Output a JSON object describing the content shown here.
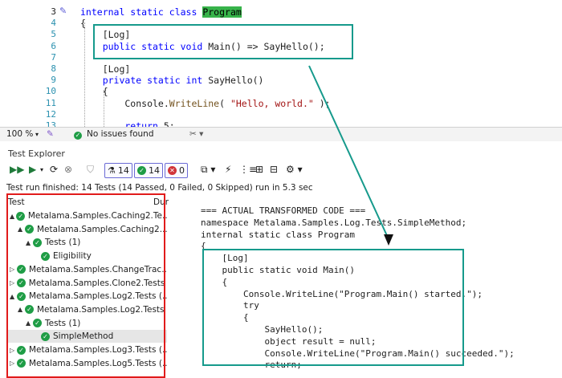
{
  "editor": {
    "line_numbers": [
      "3",
      "4",
      "5",
      "6",
      "7",
      "8",
      "9",
      "10",
      "11",
      "12",
      "13"
    ],
    "lines": [
      {
        "parts": [
          {
            "t": "internal static class ",
            "c": "kw"
          },
          {
            "t": "Program",
            "c": "hl"
          }
        ]
      },
      {
        "parts": [
          {
            "t": "{",
            "c": "ident"
          }
        ]
      },
      {
        "parts": [
          {
            "t": "    [Log]",
            "c": "ident"
          }
        ]
      },
      {
        "parts": [
          {
            "t": "    public static void ",
            "c": "kw"
          },
          {
            "t": "Main() => SayHello();",
            "c": "ident"
          }
        ]
      },
      {
        "parts": [
          {
            "t": "",
            "c": "ident"
          }
        ]
      },
      {
        "parts": [
          {
            "t": "    [Log]",
            "c": "ident"
          }
        ]
      },
      {
        "parts": [
          {
            "t": "    private static int ",
            "c": "kw"
          },
          {
            "t": "SayHello()",
            "c": "ident"
          }
        ]
      },
      {
        "parts": [
          {
            "t": "    {",
            "c": "ident"
          }
        ]
      },
      {
        "parts": [
          {
            "t": "        Console.",
            "c": "ident"
          },
          {
            "t": "WriteLine",
            "c": "method"
          },
          {
            "t": "( ",
            "c": "ident"
          },
          {
            "t": "\"Hello, world.\"",
            "c": "str"
          },
          {
            "t": " );",
            "c": "ident"
          }
        ]
      },
      {
        "parts": [
          {
            "t": "",
            "c": "ident"
          }
        ]
      },
      {
        "parts": [
          {
            "t": "        return ",
            "c": "kw"
          },
          {
            "t": "5;",
            "c": "ident"
          }
        ]
      }
    ],
    "annotation_lines": [
      "[Log]",
      "public static void Main() => SayHello();"
    ]
  },
  "statusbar": {
    "zoom": "100 %",
    "issues": "No issues found"
  },
  "test_explorer": {
    "title": "Test Explorer",
    "badges": {
      "total": "14",
      "passed": "14",
      "failed": "0"
    },
    "summary": "Test run finished: 14 Tests (14 Passed, 0 Failed, 0 Skipped) run in 5.3 sec",
    "tree_header": {
      "test": "Test",
      "duration": "Dur"
    },
    "tree": [
      {
        "label": "Metalama.Samples.Caching2.Te...",
        "depth": 0,
        "arrow": "▲",
        "selected": false
      },
      {
        "label": "Metalama.Samples.Caching2....",
        "depth": 1,
        "arrow": "▲",
        "selected": false
      },
      {
        "label": "Tests (1)",
        "depth": 2,
        "arrow": "▲",
        "selected": false
      },
      {
        "label": "Eligibility",
        "depth": 3,
        "arrow": "",
        "selected": false
      },
      {
        "label": "Metalama.Samples.ChangeTrac...",
        "depth": 0,
        "arrow": "▷",
        "selected": false
      },
      {
        "label": "Metalama.Samples.Clone2.Tests .",
        "depth": 0,
        "arrow": "▷",
        "selected": false
      },
      {
        "label": "Metalama.Samples.Log2.Tests (...",
        "depth": 0,
        "arrow": "▲",
        "selected": false
      },
      {
        "label": "Metalama.Samples.Log2.Tests ...",
        "depth": 1,
        "arrow": "▲",
        "selected": false
      },
      {
        "label": "Tests (1)",
        "depth": 2,
        "arrow": "▲",
        "selected": false
      },
      {
        "label": "SimpleMethod",
        "depth": 3,
        "arrow": "",
        "selected": true
      },
      {
        "label": "Metalama.Samples.Log3.Tests (...",
        "depth": 0,
        "arrow": "▷",
        "selected": false
      },
      {
        "label": "Metalama.Samples.Log5.Tests (...",
        "depth": 0,
        "arrow": "▷",
        "selected": false
      }
    ]
  },
  "preview": {
    "lines": [
      "=== ACTUAL TRANSFORMED CODE ===",
      "namespace Metalama.Samples.Log.Tests.SimpleMethod;",
      "internal static class Program",
      "{",
      "    [Log]",
      "    public static void Main()",
      "    {",
      "        Console.WriteLine(\"Program.Main() started.\");",
      "        try",
      "        {",
      "            SayHello();",
      "            object result = null;",
      "            Console.WriteLine(\"Program.Main() succeeded.\");",
      "            return;"
    ]
  },
  "colors": {
    "annotation": "#169a8c",
    "highlight_box": "#e11b1b",
    "pass": "#1f9d46",
    "fail": "#d13438"
  }
}
